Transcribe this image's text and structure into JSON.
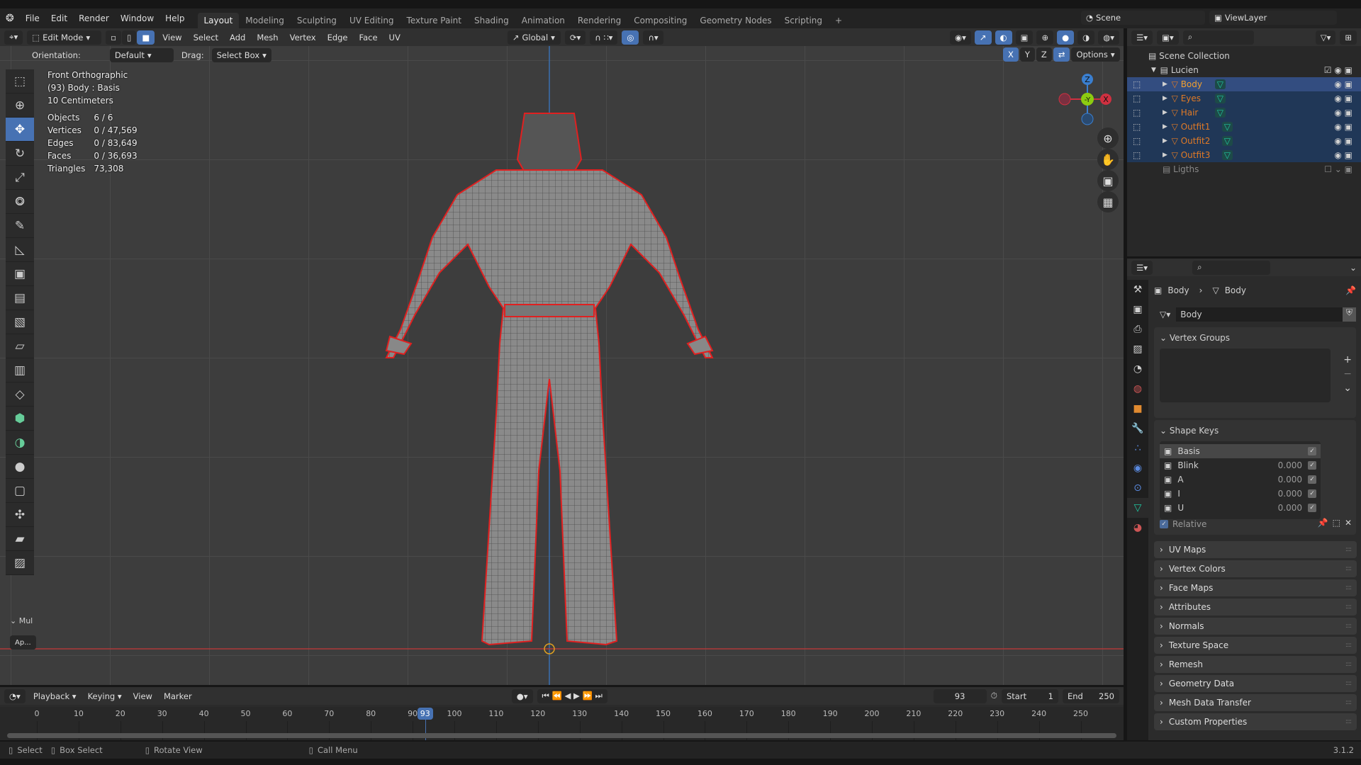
{
  "topbar": {
    "menus": [
      "File",
      "Edit",
      "Render",
      "Window",
      "Help"
    ],
    "workspaces": [
      "Layout",
      "Modeling",
      "Sculpting",
      "UV Editing",
      "Texture Paint",
      "Shading",
      "Animation",
      "Rendering",
      "Compositing",
      "Geometry Nodes",
      "Scripting"
    ],
    "add_tab": "+",
    "scene": "Scene",
    "view_layer": "ViewLayer"
  },
  "viewport_header": {
    "mode": "Edit Mode",
    "menus": [
      "View",
      "Select",
      "Add",
      "Mesh",
      "Vertex",
      "Edge",
      "Face",
      "UV"
    ],
    "transform_orientation": "Global"
  },
  "tool_settings": {
    "orientation_label": "Orientation:",
    "orientation_value": "Default",
    "drag_label": "Drag:",
    "drag_value": "Select Box",
    "axes": [
      "X",
      "Y",
      "Z"
    ],
    "options": "Options"
  },
  "overlay": {
    "view_name": "Front Orthographic",
    "object_info": "(93) Body : Basis",
    "scale": "10 Centimeters",
    "stats": [
      {
        "label": "Objects",
        "value": "6 / 6"
      },
      {
        "label": "Vertices",
        "value": "0 / 47,569"
      },
      {
        "label": "Edges",
        "value": "0 / 83,649"
      },
      {
        "label": "Faces",
        "value": "0 / 36,693"
      },
      {
        "label": "Triangles",
        "value": "73,308"
      }
    ]
  },
  "gizmo": {
    "z": "Z",
    "y": "-Y",
    "x": "X"
  },
  "toolbar": {
    "panel_label": "Mul",
    "apply_label": "Ap..."
  },
  "outliner": {
    "scene_collection": "Scene Collection",
    "collection": "Lucien",
    "objects": [
      "Body",
      "Eyes",
      "Hair",
      "Outfit1",
      "Outfit2",
      "Outfit3"
    ],
    "other_collection": "Ligths"
  },
  "properties": {
    "breadcrumb_object": "Body",
    "breadcrumb_data": "Body",
    "mesh_name": "Body",
    "vertex_groups": "Vertex Groups",
    "shape_keys_title": "Shape Keys",
    "shape_keys": [
      {
        "name": "Basis",
        "value": ""
      },
      {
        "name": "Blink",
        "value": "0.000"
      },
      {
        "name": "A",
        "value": "0.000"
      },
      {
        "name": "I",
        "value": "0.000"
      },
      {
        "name": "U",
        "value": "0.000"
      }
    ],
    "relative": "Relative",
    "panels": [
      "UV Maps",
      "Vertex Colors",
      "Face Maps",
      "Attributes",
      "Normals",
      "Texture Space",
      "Remesh",
      "Geometry Data",
      "Mesh Data Transfer",
      "Custom Properties"
    ]
  },
  "timeline": {
    "menus": [
      "Playback",
      "Keying",
      "View",
      "Marker"
    ],
    "current_frame": "93",
    "start_label": "Start",
    "start": "1",
    "end_label": "End",
    "end": "250",
    "ticks": [
      "0",
      "10",
      "20",
      "30",
      "40",
      "50",
      "60",
      "70",
      "80",
      "90",
      "100",
      "110",
      "120",
      "130",
      "140",
      "150",
      "160",
      "170",
      "180",
      "190",
      "200",
      "210",
      "220",
      "230",
      "240",
      "250"
    ]
  },
  "status": {
    "items": [
      "Select",
      "Box Select",
      "Rotate View",
      "Call Menu"
    ],
    "version": "3.1.2"
  },
  "colors": {
    "accent": "#4772b3",
    "object_orange": "#e07a26",
    "mesh_teal": "#1fc7a0",
    "seam_red": "#e02020"
  }
}
